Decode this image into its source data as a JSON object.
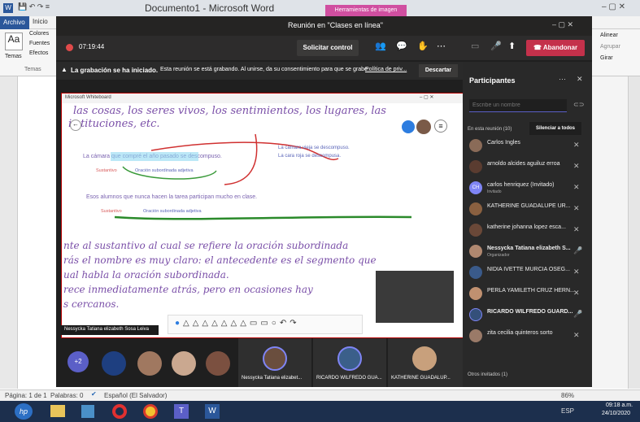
{
  "word": {
    "window_title": "Documento1 - Microsoft Word",
    "contextual_tab": "Herramientas de imagen",
    "tabs": [
      "Archivo",
      "Inicio"
    ],
    "ribbon_left": [
      "Colores",
      "Fuentes",
      "Efectos",
      "Temas",
      "Temas"
    ],
    "ribbon_right": [
      "Alinear",
      "Agrupar",
      "Girar"
    ],
    "status": {
      "page": "Página: 1 de 1",
      "words": "Palabras: 0",
      "language": "Español (El Salvador)",
      "zoom": "86%"
    },
    "taskbar": {
      "lang": "ESP",
      "time": "09:18 a.m.",
      "date": "24/10/2020"
    }
  },
  "teams": {
    "meeting_title": "Reunión en \"Clases en línea\"",
    "timer": "07:19:44",
    "request_control": "Solicitar control",
    "leave": "Abandonar",
    "recording_banner": "La grabación se ha iniciado.",
    "recording_detail": "Esta reunión se está grabando. Al unirse, da su consentimiento para que se grabe.",
    "privacy_link": "Política de priv...",
    "dismiss": "Descartar",
    "shared_window_title": "Microsoft Whiteboard",
    "share_presenter": "Nessycka Tatiana elizabeth Sosa Leiva",
    "whiteboard": {
      "line1": "las cosas, los seres vivos, los sentimientos, los lugares, las",
      "line2": "i  stituciones, etc.",
      "ex1": "La cámara que compré el año pasado se descompuso.",
      "ex1_sustantivo": "Sustantivo",
      "ex1_oracion": "Oración subordinada adjetiva",
      "ex1b_line1": "La cámara vieja se descompuso.",
      "ex1b_line2": "La cara roja se descompusa.",
      "ex2": "Esos alumnos que nunca hacen la tarea participan mucho en clase.",
      "ex2_sustantivo": "Sustantivo",
      "ex2_oracion": "Oración subordinada adjetiva",
      "p1": "nte al sustantivo al cual se refiere la oración subordinada",
      "p2": "rás el nombre es muy claro: el antecedente es el segmento que",
      "p3": "ual habla la oración subordinada.",
      "p4": "rece inmediatamente atrás, pero en ocasiones hay",
      "p5": "s cercanos."
    },
    "video_strip": {
      "more": "+2",
      "names": [
        "Nessycka Tatiana elizabet...",
        "RICARDO WILFREDO GUA...",
        "KATHERINE GUADALUP..."
      ]
    },
    "panel": {
      "title": "Participantes",
      "search_placeholder": "Escribe un nombre",
      "in_meeting": "En esta reunión (10)",
      "mute_all": "Silenciar a todos",
      "participants": [
        {
          "name": "Carlos Ingles",
          "sub": ""
        },
        {
          "name": "arnoldo alcides aguiluz erroa",
          "sub": ""
        },
        {
          "name": "carlos henriquez (Invitado)",
          "sub": "Invitado",
          "initials": "CH"
        },
        {
          "name": "KATHERINE GUADALUPE UR...",
          "sub": ""
        },
        {
          "name": "katherine johanna lopez esca...",
          "sub": ""
        },
        {
          "name": "Nessycka Tatiana elizabeth S...",
          "sub": "Organizador"
        },
        {
          "name": "NIDIA IVETTE MURCIA OSEG...",
          "sub": ""
        },
        {
          "name": "PERLA YAMILETH CRUZ HERN...",
          "sub": ""
        },
        {
          "name": "RICARDO WILFREDO GUARD...",
          "sub": ""
        },
        {
          "name": "zita cecilia quinteros sorto",
          "sub": ""
        }
      ],
      "others": "Otros invitados (1)"
    }
  }
}
